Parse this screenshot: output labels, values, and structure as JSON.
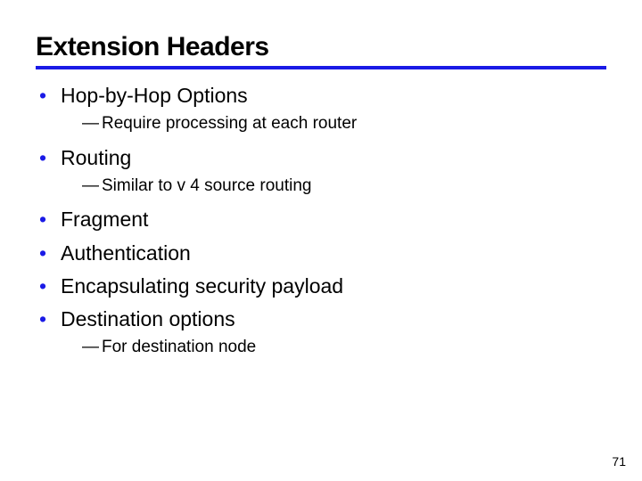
{
  "title": "Extension Headers",
  "items": {
    "i0": {
      "label": "Hop-by-Hop Options",
      "sub": "Require processing at each router"
    },
    "i1": {
      "label": "Routing",
      "sub": "Similar to v 4 source routing"
    },
    "i2": {
      "label": "Fragment"
    },
    "i3": {
      "label": "Authentication"
    },
    "i4": {
      "label": "Encapsulating security payload"
    },
    "i5": {
      "label": "Destination options",
      "sub": "For destination node"
    }
  },
  "page_number": "71"
}
